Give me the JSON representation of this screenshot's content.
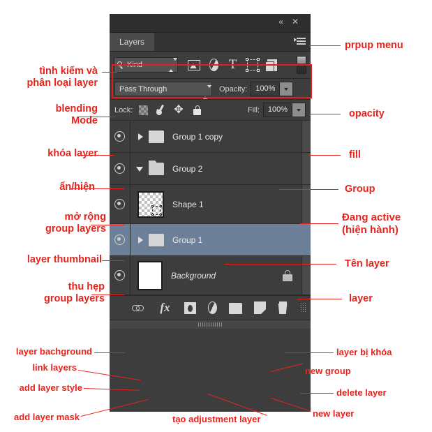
{
  "app": {
    "panel_title": "Layers",
    "window_buttons": {
      "collapse": "«",
      "close": "✕"
    }
  },
  "filter_bar": {
    "kind_label": "Kind",
    "icons": [
      {
        "name": "pixel-layers-filter-icon",
        "label": "Pixel layers"
      },
      {
        "name": "adjustment-layers-filter-icon",
        "label": "Adjustment layers"
      },
      {
        "name": "type-layers-filter-icon",
        "label": "T"
      },
      {
        "name": "shape-layers-filter-icon",
        "label": "Shape layers"
      },
      {
        "name": "smart-object-filter-icon",
        "label": "Smart objects"
      }
    ],
    "toggle_label": "Filter on/off"
  },
  "blend_row": {
    "blend_mode": "Pass Through",
    "opacity_label": "Opacity:",
    "opacity_value": "100%"
  },
  "lock_row": {
    "lock_label": "Lock:",
    "lock_icons": [
      "lock-transparent-pixels-icon",
      "lock-image-pixels-icon",
      "lock-position-icon",
      "lock-all-icon"
    ],
    "fill_label": "Fill:",
    "fill_value": "100%"
  },
  "layers": [
    {
      "name": "Group 1 copy",
      "type": "group",
      "expanded": false,
      "visible": true,
      "active": false,
      "locked": false
    },
    {
      "name": "Group 2",
      "type": "group",
      "expanded": true,
      "visible": true,
      "active": false,
      "locked": false
    },
    {
      "name": "Shape 1",
      "type": "shape",
      "expanded": false,
      "visible": true,
      "active": false,
      "locked": false
    },
    {
      "name": "Group 1",
      "type": "group",
      "expanded": false,
      "visible": true,
      "active": true,
      "locked": false
    },
    {
      "name": "Background",
      "type": "background",
      "expanded": false,
      "visible": true,
      "active": false,
      "locked": true
    }
  ],
  "bottom_toolbar": [
    {
      "name": "link-layers-button",
      "label": "Link layers"
    },
    {
      "name": "add-layer-style-button",
      "label": "fx"
    },
    {
      "name": "add-layer-mask-button",
      "label": "Add layer mask"
    },
    {
      "name": "new-adjustment-layer-button",
      "label": "Create new fill or adjustment layer"
    },
    {
      "name": "new-group-button",
      "label": "Create a new group"
    },
    {
      "name": "new-layer-button",
      "label": "Create a new layer"
    },
    {
      "name": "delete-layer-button",
      "label": "Delete layer"
    }
  ],
  "annotations": {
    "left": [
      {
        "id": "search-sort",
        "text": "tình kiếm và\nphân loại layer"
      },
      {
        "id": "blending-mode",
        "text": "blending\nMode"
      },
      {
        "id": "lock-layer",
        "text": "khóa layer"
      },
      {
        "id": "show-hide",
        "text": "ẩn/hiện"
      },
      {
        "id": "expand-group",
        "text": "mở rộng\ngroup layers"
      },
      {
        "id": "layer-thumbnail",
        "text": "layer thumbnail"
      },
      {
        "id": "collapse-group",
        "text": "thu hẹp\ngroup layers"
      },
      {
        "id": "layer-background",
        "text": "layer bachground"
      },
      {
        "id": "link-layers",
        "text": "link layers"
      },
      {
        "id": "add-layer-style",
        "text": "add layer style"
      },
      {
        "id": "add-layer-mask",
        "text": "add layer mask"
      }
    ],
    "right": [
      {
        "id": "popup-menu",
        "text": "prpup menu"
      },
      {
        "id": "opacity",
        "text": "opacity"
      },
      {
        "id": "fill",
        "text": "fill"
      },
      {
        "id": "group",
        "text": "Group"
      },
      {
        "id": "active-layer",
        "text": "Đang active\n(hiện hành)"
      },
      {
        "id": "layer-name",
        "text": "Tên layer"
      },
      {
        "id": "layer",
        "text": "layer"
      },
      {
        "id": "locked-layer",
        "text": "layer bị khóa"
      },
      {
        "id": "new-group",
        "text": "new group"
      },
      {
        "id": "delete-layer",
        "text": "delete layer"
      },
      {
        "id": "new-layer",
        "text": "new layer"
      }
    ],
    "bottom": [
      {
        "id": "adjustment-layer",
        "text": "tạo adjustment layer"
      }
    ]
  },
  "colors": {
    "annotation": "#e8231c",
    "panel_bg": "#3d3d3d",
    "active_layer": "#6c8099",
    "highlight_box": "#e02020"
  }
}
